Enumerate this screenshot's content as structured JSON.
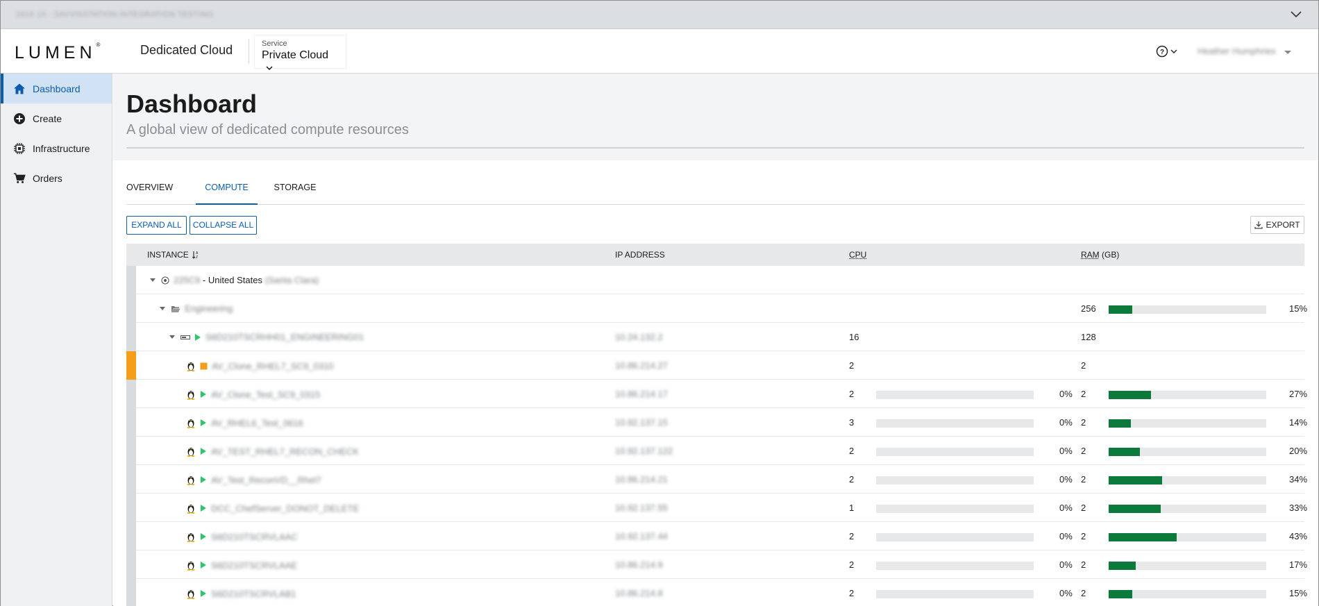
{
  "topbar": {
    "environment": "2015 14 - SAVVISSTATION INTEGRATION TESTING"
  },
  "header": {
    "logo": "LUMEN",
    "logo_mark": "®",
    "product": "Dedicated Cloud",
    "service_label": "Service",
    "service_value": "Private Cloud",
    "user_name": "Heather Humphries"
  },
  "sidebar": {
    "items": [
      {
        "label": "Dashboard",
        "icon": "home-icon",
        "active": true
      },
      {
        "label": "Create",
        "icon": "plus-circle-icon",
        "active": false
      },
      {
        "label": "Infrastructure",
        "icon": "chip-icon",
        "active": false
      },
      {
        "label": "Orders",
        "icon": "cart-icon",
        "active": false
      }
    ]
  },
  "page": {
    "title": "Dashboard",
    "subtitle": "A global view of dedicated compute resources"
  },
  "tabs": [
    {
      "label": "OVERVIEW",
      "active": false
    },
    {
      "label": "COMPUTE",
      "active": true
    },
    {
      "label": "STORAGE",
      "active": false
    }
  ],
  "buttons": {
    "expand_all": "EXPAND ALL",
    "collapse_all": "COLLAPSE ALL",
    "export": "EXPORT"
  },
  "table": {
    "headers": {
      "instance": "INSTANCE",
      "ip": "IP ADDRESS",
      "cpu": "CPU",
      "ram": "RAM",
      "ram_unit": "(GB)"
    },
    "region": {
      "code": "225C9",
      "sep": " - ",
      "country": "United States",
      "city": "(Santa Clara)"
    },
    "group": {
      "name": "Engineering",
      "ram": "256",
      "ram_pct_label": "15%",
      "ram_pct": 15
    },
    "host": {
      "name": "S6D210TSCRHH01_ENGINEERING01",
      "ip": "10.24.132.2",
      "cpu": "16",
      "ram": "128"
    },
    "vms": [
      {
        "name": "AV_Clone_RHEL7_SC9_0310",
        "ip": "10.86.214.27",
        "cpu": "2",
        "ram": "2",
        "state": "stopped",
        "warn": true
      },
      {
        "name": "AV_Clone_Test_SC9_0315",
        "ip": "10.86.214.17",
        "cpu": "2",
        "cpu_pct_label": "0%",
        "cpu_pct": 0,
        "ram": "2",
        "ram_pct_label": "27%",
        "ram_pct": 27,
        "state": "running"
      },
      {
        "name": "AV_RHEL6_Test_0616",
        "ip": "10.92.137.15",
        "cpu": "3",
        "cpu_pct_label": "0%",
        "cpu_pct": 0,
        "ram": "2",
        "ram_pct_label": "14%",
        "ram_pct": 14,
        "state": "running"
      },
      {
        "name": "AV_TEST_RHEL7_RECON_CHECK",
        "ip": "10.92.137.122",
        "cpu": "2",
        "cpu_pct_label": "0%",
        "cpu_pct": 0,
        "ram": "2",
        "ram_pct_label": "20%",
        "ram_pct": 20,
        "state": "running"
      },
      {
        "name": "AV_Test_ReconVD__Rhel7",
        "ip": "10.86.214.21",
        "cpu": "2",
        "cpu_pct_label": "0%",
        "cpu_pct": 0,
        "ram": "2",
        "ram_pct_label": "34%",
        "ram_pct": 34,
        "state": "running"
      },
      {
        "name": "DCC_ChefServer_DONOT_DELETE",
        "ip": "10.92.137.55",
        "cpu": "1",
        "cpu_pct_label": "0%",
        "cpu_pct": 0,
        "ram": "2",
        "ram_pct_label": "33%",
        "ram_pct": 33,
        "state": "running"
      },
      {
        "name": "S6D210TSCRVLAAC",
        "ip": "10.92.137.44",
        "cpu": "2",
        "cpu_pct_label": "0%",
        "cpu_pct": 0,
        "ram": "2",
        "ram_pct_label": "43%",
        "ram_pct": 43,
        "state": "running"
      },
      {
        "name": "S6D210TSCRVLAAE",
        "ip": "10.86.214.9",
        "cpu": "2",
        "cpu_pct_label": "0%",
        "cpu_pct": 0,
        "ram": "2",
        "ram_pct_label": "17%",
        "ram_pct": 17,
        "state": "running"
      },
      {
        "name": "S6D210TSCRVLAB1",
        "ip": "10.86.214.8",
        "cpu": "2",
        "cpu_pct_label": "0%",
        "cpu_pct": 0,
        "ram": "2",
        "ram_pct_label": "15%",
        "ram_pct": 15,
        "state": "running"
      }
    ]
  },
  "colors": {
    "accent": "#0b5cad",
    "bar_fill": "#0b7a3b",
    "bar_track": "#e6e8ea",
    "warn": "#f59e1b",
    "running": "#2fc66b",
    "stopped": "#f59e1b"
  }
}
